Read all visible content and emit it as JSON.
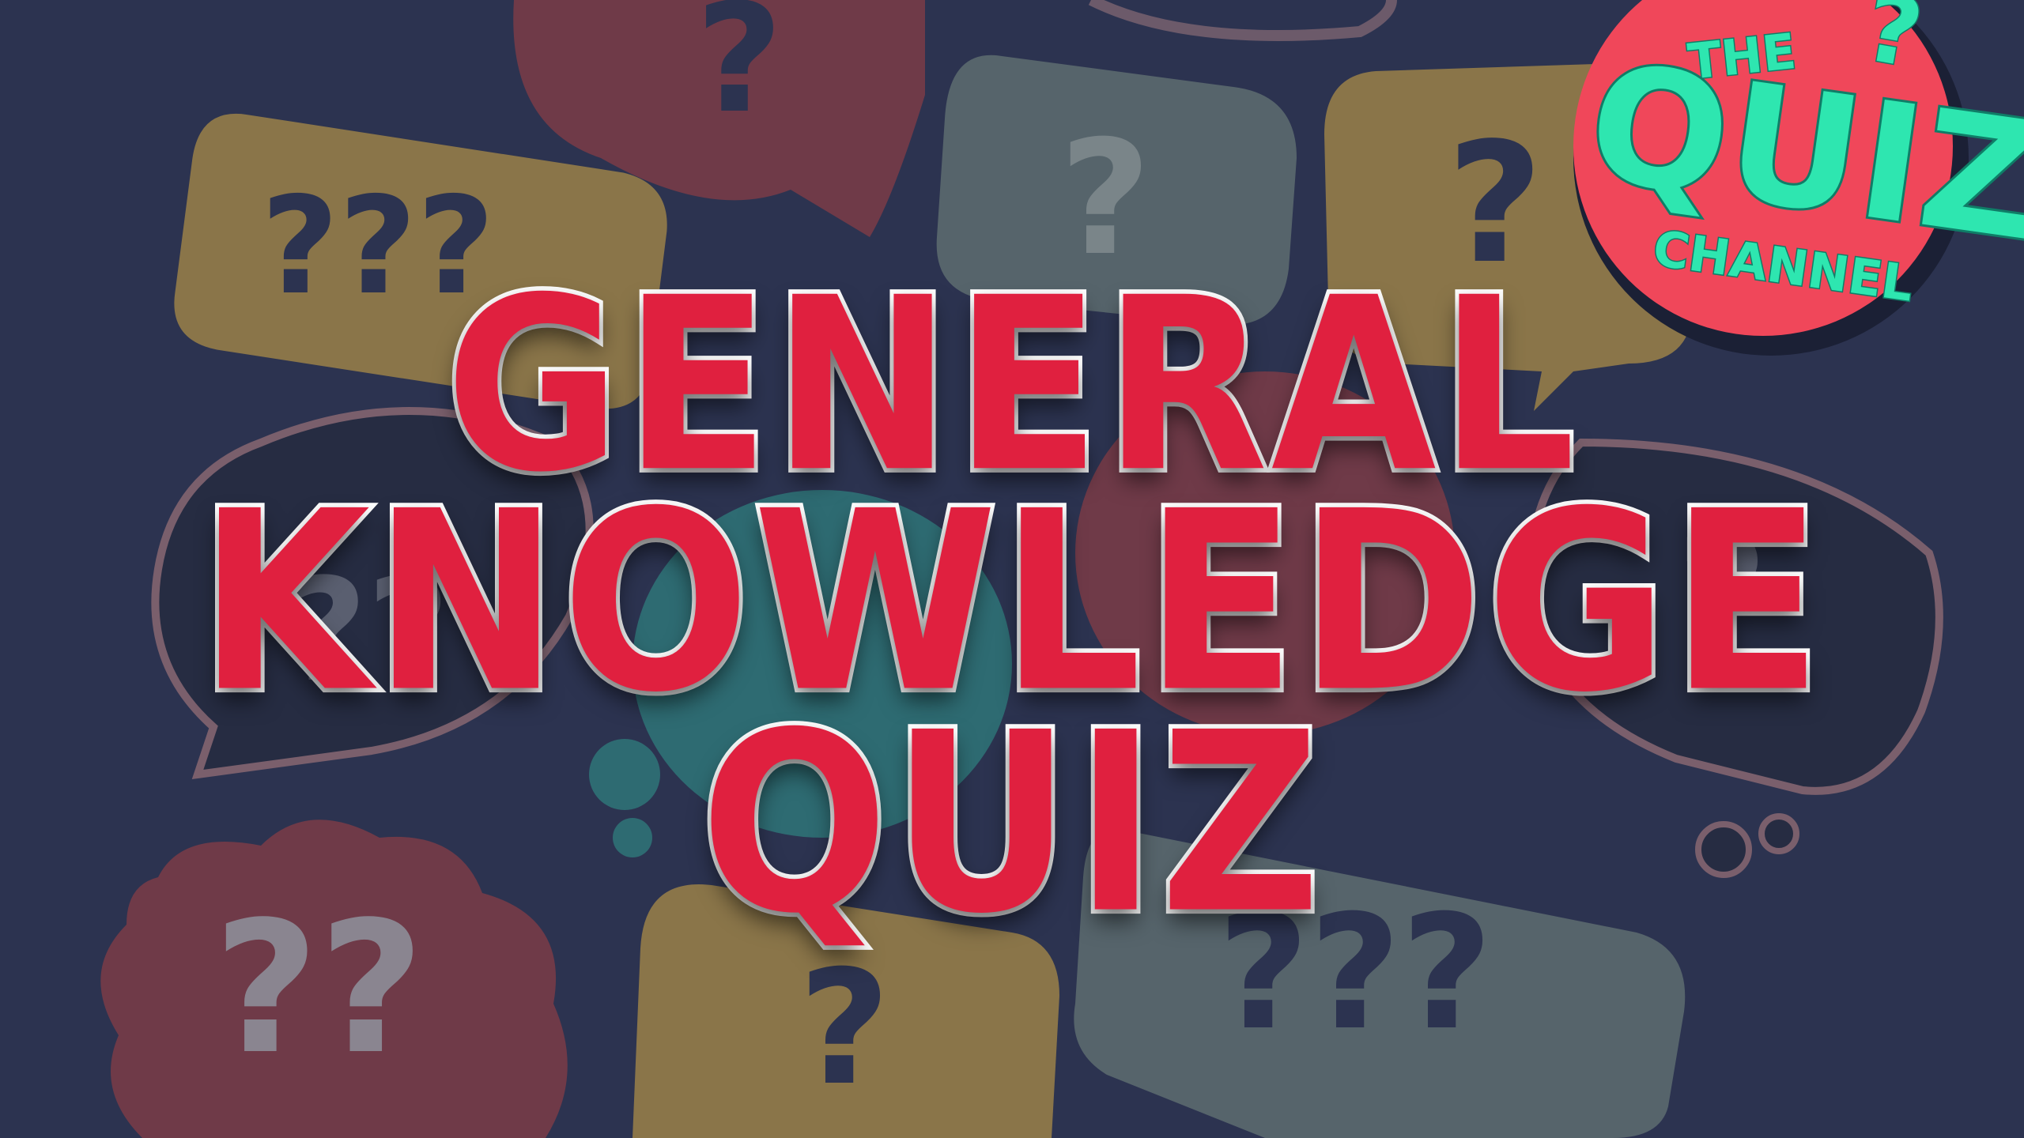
{
  "title": {
    "line1": "GENERAL",
    "line2": "KNOWLEDGE",
    "line3": "QUIZ"
  },
  "logo": {
    "the": "THE",
    "quiz": "QUIZ",
    "channel": "CHANNEL",
    "mark": "?"
  },
  "bubbles": [
    {
      "name": "bubble-yellow-top-left",
      "marks": "???"
    },
    {
      "name": "bubble-red-top",
      "marks": "?"
    },
    {
      "name": "bubble-grey-top",
      "marks": "?"
    },
    {
      "name": "bubble-yellow-top-right",
      "marks": "?"
    },
    {
      "name": "bubble-dark-left",
      "marks": "??"
    },
    {
      "name": "bubble-dark-right",
      "marks": "?"
    },
    {
      "name": "bubble-red-bottom-left",
      "marks": "??"
    },
    {
      "name": "bubble-yellow-bottom",
      "marks": "?"
    },
    {
      "name": "bubble-grey-bottom-right",
      "marks": "???"
    }
  ],
  "colors": {
    "background": "#2c3350",
    "title_fill": "#e0203f",
    "title_outline": "#ffffff",
    "logo_circle": "#f0475a",
    "logo_text": "#2ee6b0",
    "bubble_yellow": "#8a7549",
    "bubble_red": "#6f3a48",
    "bubble_grey": "#56646b",
    "bubble_teal": "#2e6b72"
  }
}
